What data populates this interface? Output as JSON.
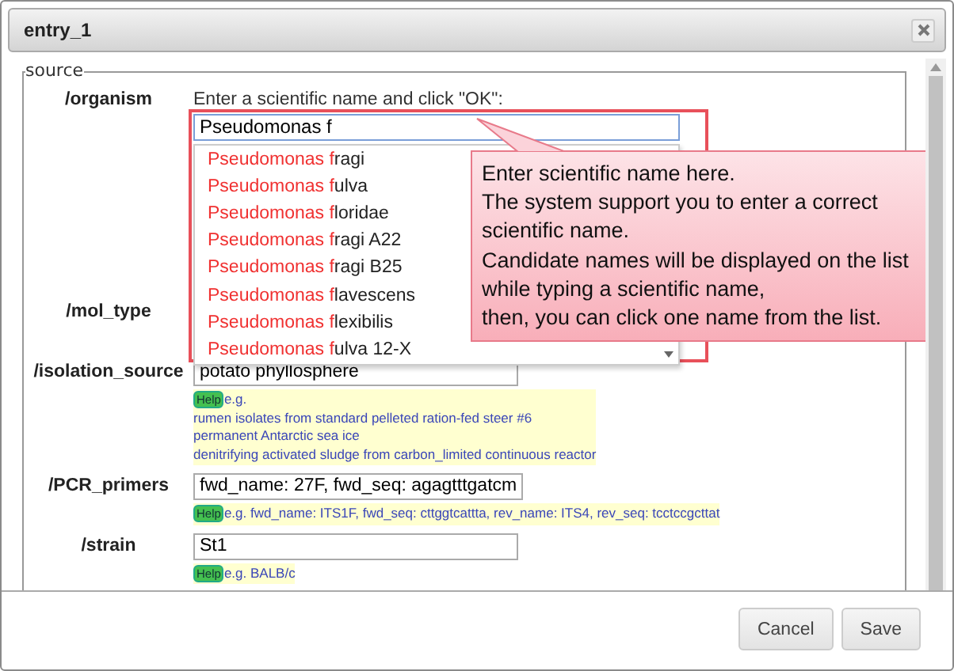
{
  "window": {
    "title": "entry_1"
  },
  "fieldset": {
    "legend": "source",
    "fields": [
      {
        "kind": "autocomplete",
        "label": "/organism",
        "prompt": "Enter a scientific name and click \"OK\":",
        "value": "Pseudomonas f",
        "suggestions": [
          {
            "matched": "Pseudomonas f",
            "rest": "ragi"
          },
          {
            "matched": "Pseudomonas f",
            "rest": "ulva"
          },
          {
            "matched": "Pseudomonas f",
            "rest": "loridae"
          },
          {
            "matched": "Pseudomonas f",
            "rest": "ragi A22"
          },
          {
            "matched": "Pseudomonas f",
            "rest": "ragi B25"
          },
          {
            "matched": "Pseudomonas f",
            "rest": "lavescens"
          },
          {
            "matched": "Pseudomonas f",
            "rest": "lexibilis"
          },
          {
            "matched": "Pseudomonas f",
            "rest": "ulva 12-X"
          }
        ]
      },
      {
        "kind": "hidden",
        "label": "/mol_type"
      },
      {
        "kind": "text",
        "label": "/isolation_source",
        "value": "potato phyllosphere",
        "help": {
          "badge": "Help",
          "lines": [
            "e.g.",
            "rumen isolates from standard pelleted ration-fed steer #6",
            "permanent Antarctic sea ice",
            "denitrifying activated sludge from carbon_limited continuous reactor"
          ]
        }
      },
      {
        "kind": "text",
        "label": "/PCR_primers",
        "value": "fwd_name: 27F, fwd_seq: agagtttgatcm",
        "help": {
          "badge": "Help",
          "lines": [
            "e.g. fwd_name: ITS1F, fwd_seq: cttggtcattta, rev_name: ITS4, rev_seq: tcctccgcttat"
          ]
        }
      },
      {
        "kind": "text",
        "label": "/strain",
        "value": "St1",
        "help": {
          "badge": "Help",
          "lines": [
            "e.g. BALB/c"
          ]
        }
      }
    ]
  },
  "callout": {
    "text": "Enter scientific name here.\nThe system support you to enter a correct\nscientific name.\nCandidate names will be displayed on the list\nwhile typing a scientific name,\nthen, you can click one name from the list."
  },
  "buttons": [
    "Cancel",
    "Save"
  ]
}
